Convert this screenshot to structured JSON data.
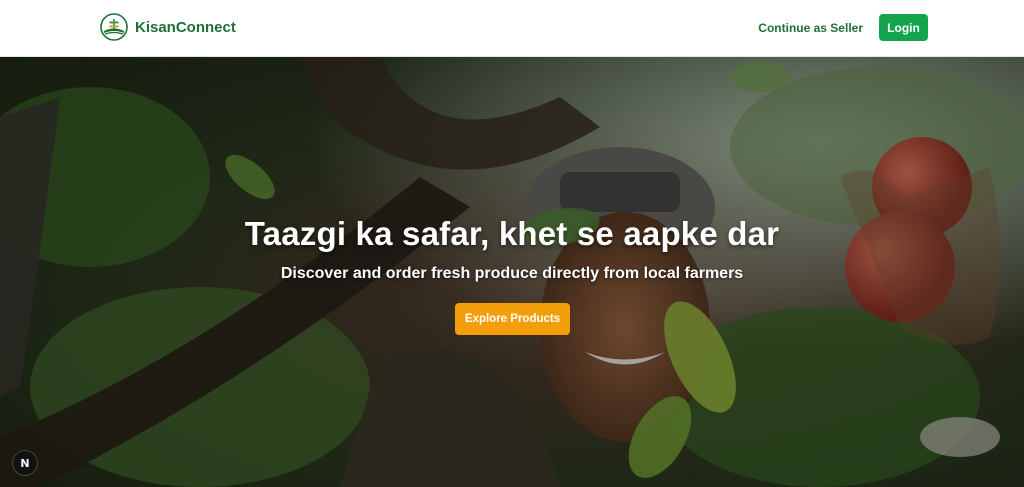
{
  "header": {
    "brand_name": "KisanConnect",
    "seller_link": "Continue as Seller",
    "login_label": "Login"
  },
  "hero": {
    "title": "Taazgi ka safar, khet se aapke dar",
    "subtitle": "Discover and order fresh produce directly from local farmers",
    "cta_label": "Explore Products"
  },
  "badge": {
    "label": "N"
  },
  "colors": {
    "brand_green": "#1f6f37",
    "login_green": "#14a44d",
    "cta_orange": "#f59e0b"
  },
  "icons": {
    "logo": "leaf-logo-icon"
  }
}
